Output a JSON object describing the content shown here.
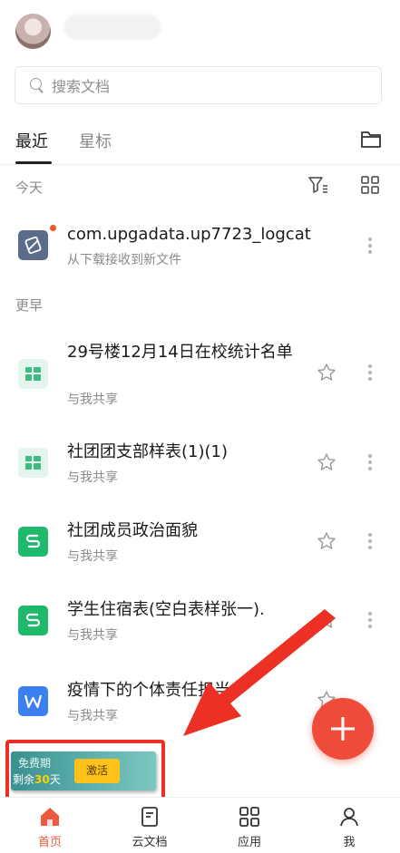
{
  "search": {
    "placeholder": "搜索文档"
  },
  "tabs": [
    {
      "label": "最近",
      "active": true
    },
    {
      "label": "星标",
      "active": false
    }
  ],
  "sections": {
    "today": "今天",
    "earlier": "更早"
  },
  "today_files": [
    {
      "title": "com.upgadata.up7723_logcat",
      "subtitle": "从下载接收到新文件",
      "icon": "file-download-icon",
      "color": "#5b6b8c",
      "unread": true
    }
  ],
  "earlier_files": [
    {
      "title": "29号楼12月14日在校统计名单",
      "subtitle": "与我共享",
      "icon": "sheet-table-icon",
      "color": "#3dbb83"
    },
    {
      "title": "社团团支部样表(1)(1)",
      "subtitle": "与我共享",
      "icon": "sheet-table-icon",
      "color": "#3dbb83"
    },
    {
      "title": "社团成员政治面貌",
      "subtitle": "与我共享",
      "icon": "spreadsheet-s-icon",
      "color": "#1fb96c"
    },
    {
      "title": "学生住宿表(空白表样张一).",
      "subtitle": "与我共享",
      "icon": "spreadsheet-s-icon",
      "color": "#1fb96c"
    },
    {
      "title": "疫情下的个体责任担当",
      "subtitle": "与我共享",
      "icon": "word-w-icon",
      "color": "#3c7ff0"
    }
  ],
  "trial_banner": {
    "line1": "免费期",
    "line2_prefix": "剩余",
    "days": "30",
    "line2_suffix": "天",
    "button": "激活"
  },
  "bottom_nav": [
    {
      "label": "首页",
      "icon": "home-icon",
      "active": true
    },
    {
      "label": "云文档",
      "icon": "cloud-doc-icon",
      "active": false
    },
    {
      "label": "应用",
      "icon": "apps-grid-icon",
      "active": false
    },
    {
      "label": "我",
      "icon": "person-icon",
      "active": false
    }
  ],
  "colors": {
    "accent": "#ee5a3f",
    "fab": "#ef4b3b",
    "annotation": "#ec3023"
  }
}
